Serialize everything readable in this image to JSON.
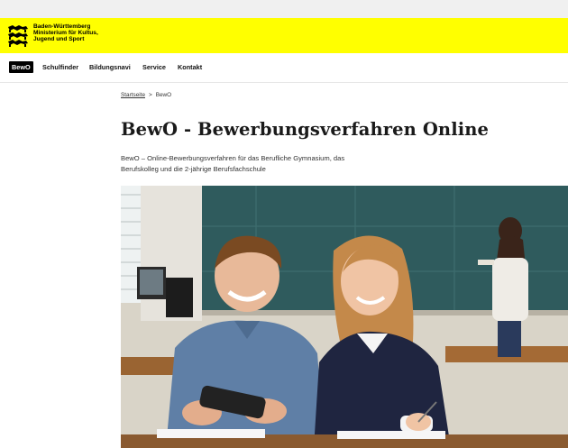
{
  "logo": {
    "lines": [
      "Baden-Württemberg",
      "Ministerium für Kultus,",
      "Jugend und Sport"
    ],
    "emblem_icon": "stag-lions-crest-icon"
  },
  "nav": {
    "items": [
      {
        "label": "BewO",
        "active": true
      },
      {
        "label": "Schulfinder",
        "active": false
      },
      {
        "label": "Bildungsnavi",
        "active": false
      },
      {
        "label": "Service",
        "active": false
      },
      {
        "label": "Kontakt",
        "active": false
      }
    ]
  },
  "breadcrumb": {
    "home": "Startseite",
    "separator": ">",
    "current": "BewO"
  },
  "page": {
    "title": "BewO - Bewerbungsverfahren Online",
    "intro_line1": "BewO – Online-Bewerbungsverfahren für das Berufliche Gymnasium, das",
    "intro_line2": "Berufskolleg und die 2-jährige Berufsfachschule"
  },
  "hero": {
    "alt": "Zwei Schüler lächeln und schauen auf ein Smartphone im Klassenzimmer"
  },
  "colors": {
    "brand_yellow": "#ffff00",
    "nav_active_bg": "#000000",
    "text": "#1a1a1a"
  }
}
